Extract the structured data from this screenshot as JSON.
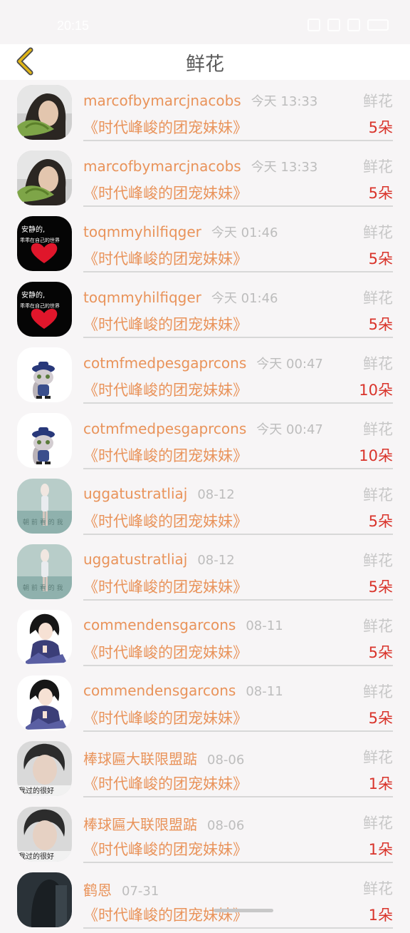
{
  "status_bar": {
    "time": "20:15"
  },
  "header": {
    "title": "鲜花",
    "back_icon": "chevron-left-icon",
    "accent_color": "#e0b516"
  },
  "colors": {
    "name": "#e9935a",
    "time": "#bdbdbd",
    "count": "#d9342b",
    "type": "#c7c7c7"
  },
  "rows": [
    {
      "name": "marcofbymarcjnacobs",
      "time": "今天 13:33",
      "type": "鲜花",
      "gift": "《时代峰峻的团宠妹妹》",
      "count": "5朵",
      "avatar": "photo-girl-leaf"
    },
    {
      "name": "marcofbymarcjnacobs",
      "time": "今天 13:33",
      "type": "鲜花",
      "gift": "《时代峰峻的团宠妹妹》",
      "count": "5朵",
      "avatar": "photo-girl-leaf"
    },
    {
      "name": "toqmmyhilfiqger",
      "time": "今天 01:46",
      "type": "鲜花",
      "gift": "《时代峰峻的团宠妹妹》",
      "count": "5朵",
      "avatar": "black-heart"
    },
    {
      "name": "toqmmyhilfiqger",
      "time": "今天 01:46",
      "type": "鲜花",
      "gift": "《时代峰峻的团宠妹妹》",
      "count": "5朵",
      "avatar": "black-heart"
    },
    {
      "name": "cotmfmedpesgaprcons",
      "time": "今天 00:47",
      "type": "鲜花",
      "gift": "《时代峰峻的团宠妹妹》",
      "count": "10朵",
      "avatar": "cartoon-bunny"
    },
    {
      "name": "cotmfmedpesgaprcons",
      "time": "今天 00:47",
      "type": "鲜花",
      "gift": "《时代峰峻的团宠妹妹》",
      "count": "10朵",
      "avatar": "cartoon-bunny"
    },
    {
      "name": "uggatustratliaj",
      "time": "08-12",
      "type": "鲜花",
      "gift": "《时代峰峻的团宠妹妹》",
      "count": "5朵",
      "avatar": "teal-figure"
    },
    {
      "name": "uggatustratliaj",
      "time": "08-12",
      "type": "鲜花",
      "gift": "《时代峰峻的团宠妹妹》",
      "count": "5朵",
      "avatar": "teal-figure"
    },
    {
      "name": "commendensgarcons",
      "time": "08-11",
      "type": "鲜花",
      "gift": "《时代峰峻的团宠妹妹》",
      "count": "5朵",
      "avatar": "anime-boy"
    },
    {
      "name": "commendensgarcons",
      "time": "08-11",
      "type": "鲜花",
      "gift": "《时代峰峻的团宠妹妹》",
      "count": "5朵",
      "avatar": "anime-boy"
    },
    {
      "name": "棒球匾大联限盟踮",
      "time": "08-06",
      "type": "鲜花",
      "gift": "《时代峰峻的团宠妹妹》",
      "count": "1朵",
      "avatar": "boy-photo"
    },
    {
      "name": "棒球匾大联限盟踮",
      "time": "08-06",
      "type": "鲜花",
      "gift": "《时代峰峻的团宠妹妹》",
      "count": "1朵",
      "avatar": "boy-photo"
    },
    {
      "name": "鹤恩",
      "time": "07-31",
      "type": "鲜花",
      "gift": "《时代峰峻的团宠妹妹》",
      "count": "1朵",
      "avatar": "dark-photo"
    }
  ],
  "avatar_text": {
    "black_heart_line1": "安静的,",
    "black_heart_line2": "乖乖在自己的世界",
    "boy_caption": "我过的很好"
  }
}
